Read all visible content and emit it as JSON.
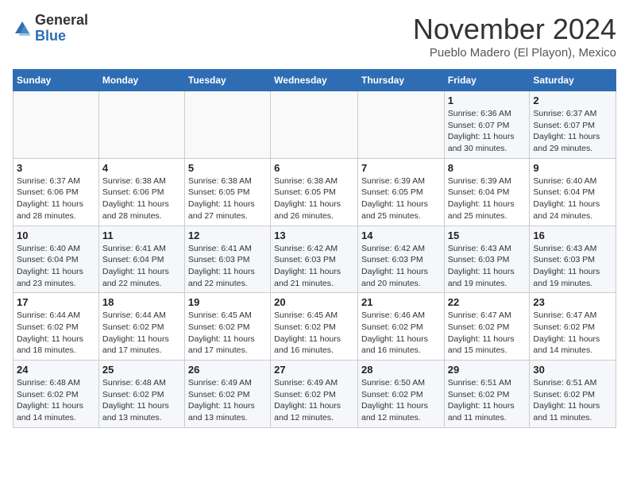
{
  "header": {
    "logo_general": "General",
    "logo_blue": "Blue",
    "month_title": "November 2024",
    "location": "Pueblo Madero (El Playon), Mexico"
  },
  "calendar": {
    "weekdays": [
      "Sunday",
      "Monday",
      "Tuesday",
      "Wednesday",
      "Thursday",
      "Friday",
      "Saturday"
    ],
    "weeks": [
      [
        {
          "day": "",
          "info": ""
        },
        {
          "day": "",
          "info": ""
        },
        {
          "day": "",
          "info": ""
        },
        {
          "day": "",
          "info": ""
        },
        {
          "day": "",
          "info": ""
        },
        {
          "day": "1",
          "info": "Sunrise: 6:36 AM\nSunset: 6:07 PM\nDaylight: 11 hours and 30 minutes."
        },
        {
          "day": "2",
          "info": "Sunrise: 6:37 AM\nSunset: 6:07 PM\nDaylight: 11 hours and 29 minutes."
        }
      ],
      [
        {
          "day": "3",
          "info": "Sunrise: 6:37 AM\nSunset: 6:06 PM\nDaylight: 11 hours and 28 minutes."
        },
        {
          "day": "4",
          "info": "Sunrise: 6:38 AM\nSunset: 6:06 PM\nDaylight: 11 hours and 28 minutes."
        },
        {
          "day": "5",
          "info": "Sunrise: 6:38 AM\nSunset: 6:05 PM\nDaylight: 11 hours and 27 minutes."
        },
        {
          "day": "6",
          "info": "Sunrise: 6:38 AM\nSunset: 6:05 PM\nDaylight: 11 hours and 26 minutes."
        },
        {
          "day": "7",
          "info": "Sunrise: 6:39 AM\nSunset: 6:05 PM\nDaylight: 11 hours and 25 minutes."
        },
        {
          "day": "8",
          "info": "Sunrise: 6:39 AM\nSunset: 6:04 PM\nDaylight: 11 hours and 25 minutes."
        },
        {
          "day": "9",
          "info": "Sunrise: 6:40 AM\nSunset: 6:04 PM\nDaylight: 11 hours and 24 minutes."
        }
      ],
      [
        {
          "day": "10",
          "info": "Sunrise: 6:40 AM\nSunset: 6:04 PM\nDaylight: 11 hours and 23 minutes."
        },
        {
          "day": "11",
          "info": "Sunrise: 6:41 AM\nSunset: 6:04 PM\nDaylight: 11 hours and 22 minutes."
        },
        {
          "day": "12",
          "info": "Sunrise: 6:41 AM\nSunset: 6:03 PM\nDaylight: 11 hours and 22 minutes."
        },
        {
          "day": "13",
          "info": "Sunrise: 6:42 AM\nSunset: 6:03 PM\nDaylight: 11 hours and 21 minutes."
        },
        {
          "day": "14",
          "info": "Sunrise: 6:42 AM\nSunset: 6:03 PM\nDaylight: 11 hours and 20 minutes."
        },
        {
          "day": "15",
          "info": "Sunrise: 6:43 AM\nSunset: 6:03 PM\nDaylight: 11 hours and 19 minutes."
        },
        {
          "day": "16",
          "info": "Sunrise: 6:43 AM\nSunset: 6:03 PM\nDaylight: 11 hours and 19 minutes."
        }
      ],
      [
        {
          "day": "17",
          "info": "Sunrise: 6:44 AM\nSunset: 6:02 PM\nDaylight: 11 hours and 18 minutes."
        },
        {
          "day": "18",
          "info": "Sunrise: 6:44 AM\nSunset: 6:02 PM\nDaylight: 11 hours and 17 minutes."
        },
        {
          "day": "19",
          "info": "Sunrise: 6:45 AM\nSunset: 6:02 PM\nDaylight: 11 hours and 17 minutes."
        },
        {
          "day": "20",
          "info": "Sunrise: 6:45 AM\nSunset: 6:02 PM\nDaylight: 11 hours and 16 minutes."
        },
        {
          "day": "21",
          "info": "Sunrise: 6:46 AM\nSunset: 6:02 PM\nDaylight: 11 hours and 16 minutes."
        },
        {
          "day": "22",
          "info": "Sunrise: 6:47 AM\nSunset: 6:02 PM\nDaylight: 11 hours and 15 minutes."
        },
        {
          "day": "23",
          "info": "Sunrise: 6:47 AM\nSunset: 6:02 PM\nDaylight: 11 hours and 14 minutes."
        }
      ],
      [
        {
          "day": "24",
          "info": "Sunrise: 6:48 AM\nSunset: 6:02 PM\nDaylight: 11 hours and 14 minutes."
        },
        {
          "day": "25",
          "info": "Sunrise: 6:48 AM\nSunset: 6:02 PM\nDaylight: 11 hours and 13 minutes."
        },
        {
          "day": "26",
          "info": "Sunrise: 6:49 AM\nSunset: 6:02 PM\nDaylight: 11 hours and 13 minutes."
        },
        {
          "day": "27",
          "info": "Sunrise: 6:49 AM\nSunset: 6:02 PM\nDaylight: 11 hours and 12 minutes."
        },
        {
          "day": "28",
          "info": "Sunrise: 6:50 AM\nSunset: 6:02 PM\nDaylight: 11 hours and 12 minutes."
        },
        {
          "day": "29",
          "info": "Sunrise: 6:51 AM\nSunset: 6:02 PM\nDaylight: 11 hours and 11 minutes."
        },
        {
          "day": "30",
          "info": "Sunrise: 6:51 AM\nSunset: 6:02 PM\nDaylight: 11 hours and 11 minutes."
        }
      ]
    ]
  }
}
